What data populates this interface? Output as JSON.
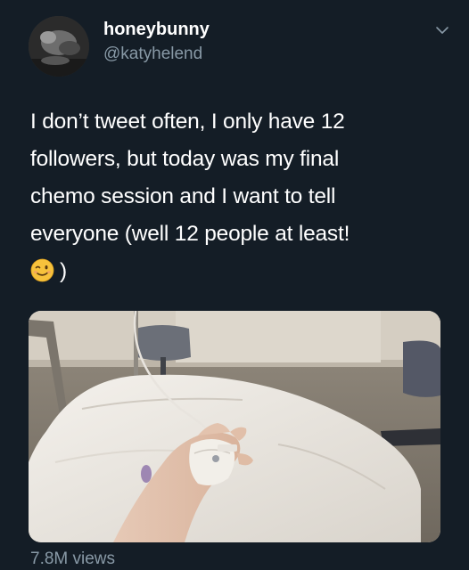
{
  "user": {
    "display_name": "honeybunny",
    "handle": "@katyhelend",
    "avatar_icon": "profile-photo"
  },
  "menu_icon": "chevron-down-icon",
  "tweet": {
    "lines": [
      "I don’t tweet often, I only have 12",
      "followers, but today was my final",
      "chemo session and I want to tell",
      "everyone (well 12 people at least!"
    ],
    "last_line_suffix": ")",
    "emoji": "winking-face-emoji"
  },
  "media": {
    "subject": "hand with IV cannula resting on white pillow"
  },
  "footer": {
    "views": "7.8M views"
  },
  "colors": {
    "background": "#141d26",
    "text_primary": "#ffffff",
    "text_secondary": "#8899a6"
  }
}
